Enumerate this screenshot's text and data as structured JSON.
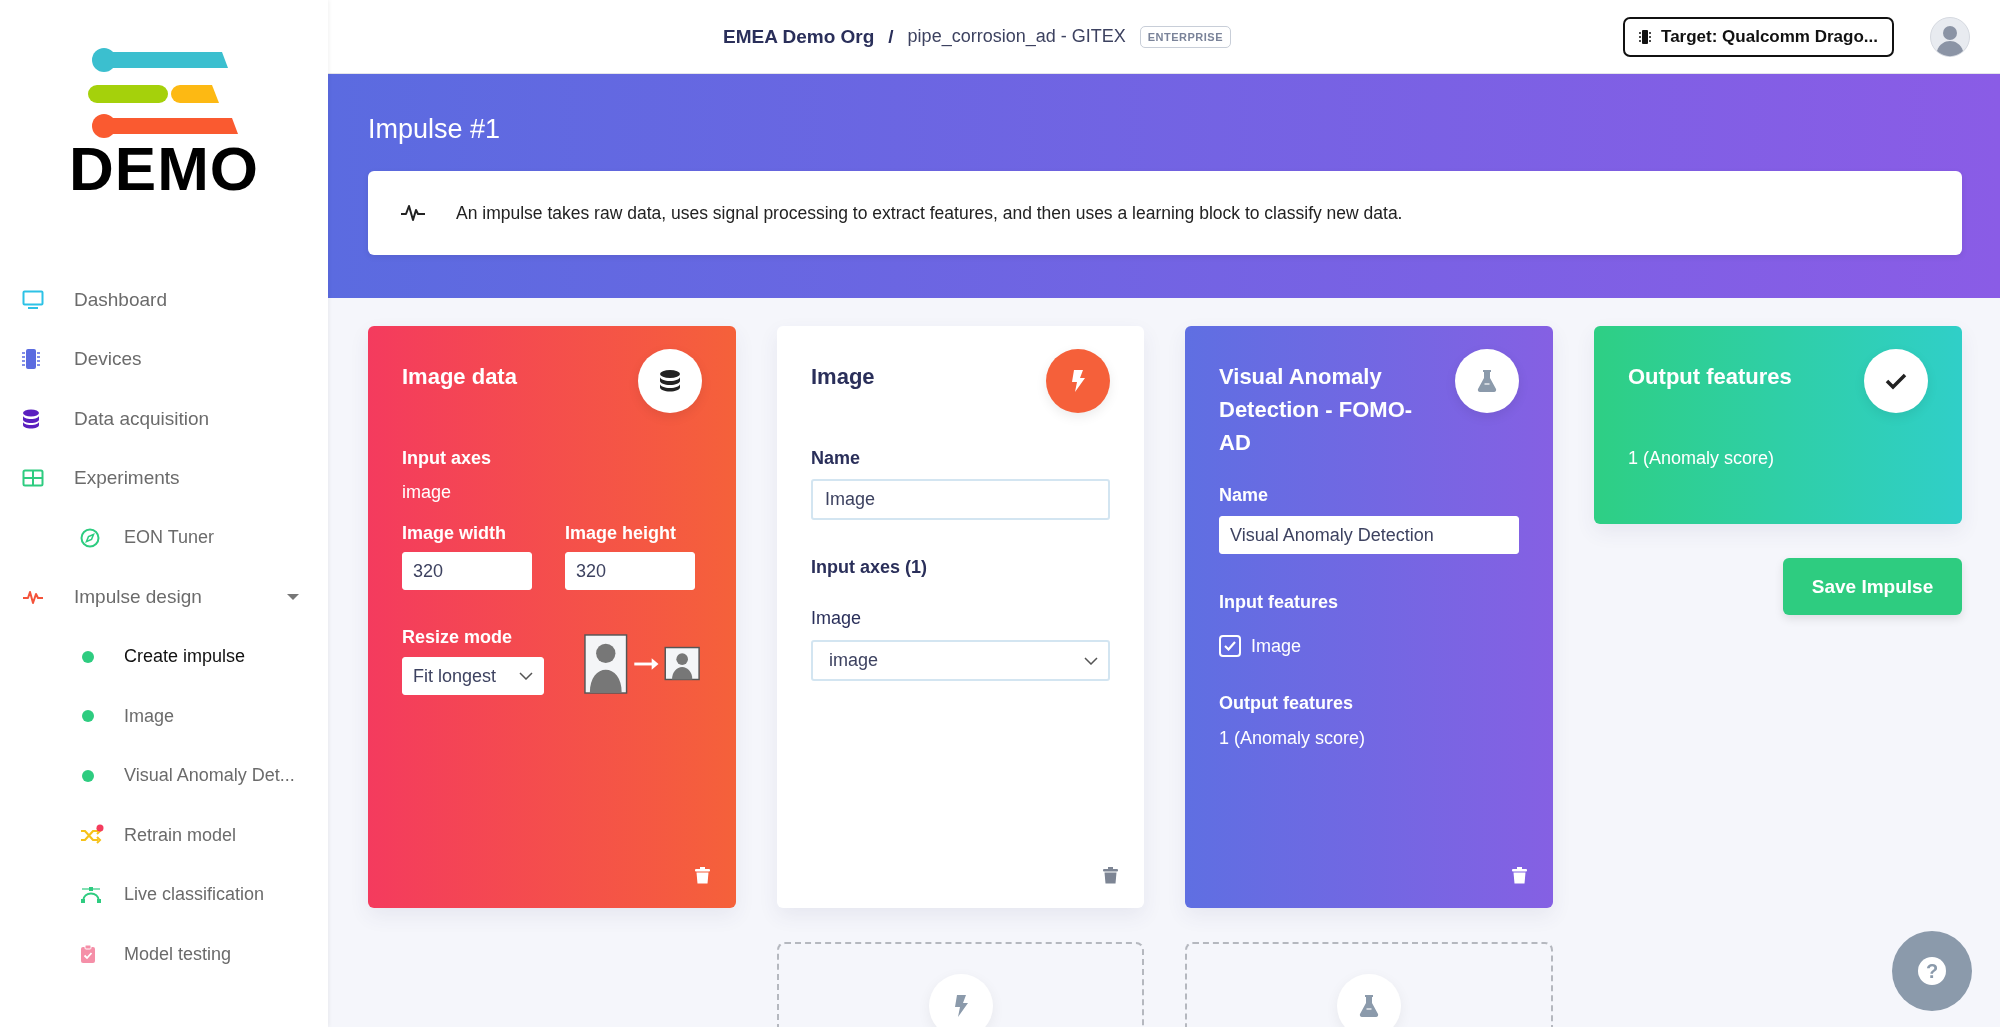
{
  "sidebar": {
    "logo_text": "DEMO",
    "items": [
      {
        "label": "Dashboard",
        "selected": false
      },
      {
        "label": "Devices",
        "selected": false
      },
      {
        "label": "Data acquisition",
        "selected": false
      },
      {
        "label": "Experiments",
        "selected": false,
        "children": [
          {
            "label": "EON Tuner",
            "kind": "icon",
            "selected": false
          }
        ]
      },
      {
        "label": "Impulse design",
        "selected": false,
        "expanded": true,
        "children": [
          {
            "label": "Create impulse",
            "kind": "dot",
            "selected": true
          },
          {
            "label": "Image",
            "kind": "dot",
            "selected": false
          },
          {
            "label": "Visual Anomaly Det...",
            "kind": "dot",
            "selected": false
          },
          {
            "label": "Retrain model",
            "kind": "icon",
            "selected": false,
            "notification": true
          },
          {
            "label": "Live classification",
            "kind": "icon",
            "selected": false
          },
          {
            "label": "Model testing",
            "kind": "icon",
            "selected": false
          }
        ]
      }
    ]
  },
  "topbar": {
    "organization": "EMEA Demo Org",
    "separator": "/",
    "project": "pipe_corrosion_ad - GITEX",
    "plan_badge": "ENTERPRISE",
    "target_button": "Target: Qualcomm Drago..."
  },
  "header": {
    "title": "Impulse #1",
    "info": "An impulse takes raw data, uses signal processing to extract features, and then uses a learning block to classify new data."
  },
  "blocks": [
    {
      "kind": "input",
      "title": "Image data",
      "input_axes_label": "Input axes",
      "input_axes_value": "image",
      "width_label": "Image width",
      "width_value": "320",
      "height_label": "Image height",
      "height_value": "320",
      "resize_label": "Resize mode",
      "resize_value": "Fit longest"
    },
    {
      "kind": "processing",
      "title": "Image",
      "name_label": "Name",
      "name_value": "Image",
      "axes_heading": "Input axes (1)",
      "axis_label": "Image",
      "axis_value": "image"
    },
    {
      "kind": "learning",
      "title": "Visual Anomaly Detection - FOMO-AD",
      "name_label": "Name",
      "name_value": "Visual Anomaly Detection",
      "input_features_label": "Input features",
      "input_feature": {
        "label": "Image",
        "checked": true
      },
      "output_features_label": "Output features",
      "output_features_value": "1 (Anomaly score)"
    },
    {
      "kind": "output",
      "title": "Output features",
      "value": "1 (Anomaly score)"
    }
  ],
  "save_button": "Save Impulse",
  "add_slots": [
    {
      "kind": "processing"
    },
    {
      "kind": "learning"
    }
  ],
  "help_button": "?"
}
